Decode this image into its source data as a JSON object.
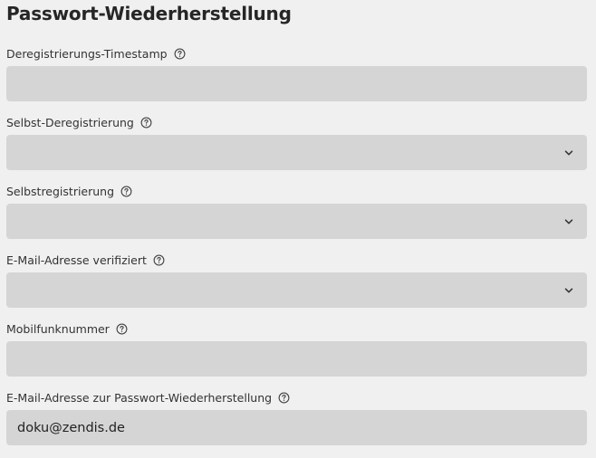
{
  "page": {
    "title": "Passwort-Wiederherstellung"
  },
  "fields": [
    {
      "label": "Deregistrierungs-Timestamp",
      "type": "text",
      "value": "",
      "icon": "help-circle-icon"
    },
    {
      "label": "Selbst-Deregistrierung",
      "type": "select",
      "value": "",
      "icon": "help-circle-icon",
      "control_icon": "chevron-down-icon"
    },
    {
      "label": "Selbstregistrierung",
      "type": "select",
      "value": "",
      "icon": "help-circle-icon",
      "control_icon": "chevron-down-icon"
    },
    {
      "label": "E-Mail-Adresse verifiziert",
      "type": "select",
      "value": "",
      "icon": "help-circle-icon",
      "control_icon": "chevron-down-icon"
    },
    {
      "label": "Mobilfunknummer",
      "type": "text",
      "value": "",
      "icon": "help-circle-icon"
    },
    {
      "label": "E-Mail-Adresse zur Passwort-Wiederherstellung",
      "type": "text",
      "value": "doku@zendis.de",
      "icon": "help-circle-icon"
    }
  ],
  "colors": {
    "background": "#f0f0f0",
    "input_background": "#d5d5d5",
    "text": "#2a2a2a"
  }
}
